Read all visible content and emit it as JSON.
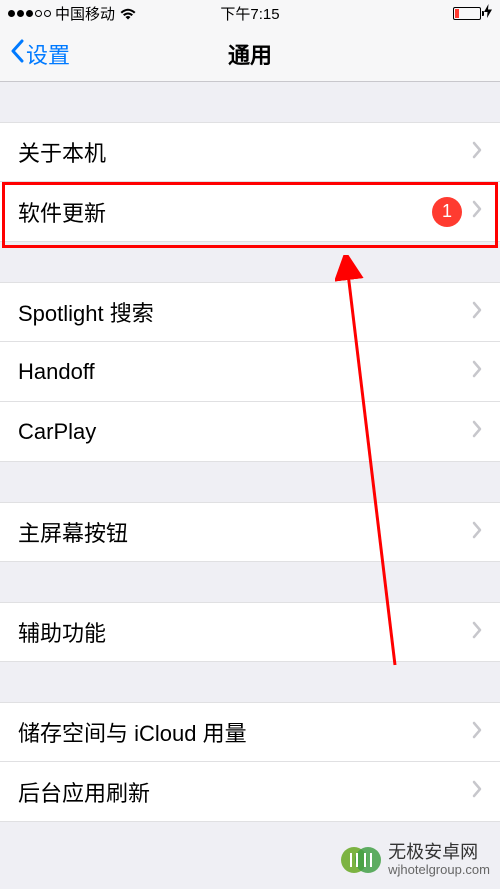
{
  "status": {
    "carrier": "中国移动",
    "time": "下午7:15"
  },
  "nav": {
    "back_label": "设置",
    "title": "通用"
  },
  "groups": [
    {
      "rows": [
        {
          "label": "关于本机",
          "badge": null
        },
        {
          "label": "软件更新",
          "badge": "1"
        }
      ]
    },
    {
      "rows": [
        {
          "label": "Spotlight 搜索",
          "badge": null
        },
        {
          "label": "Handoff",
          "badge": null
        },
        {
          "label": "CarPlay",
          "badge": null
        }
      ]
    },
    {
      "rows": [
        {
          "label": "主屏幕按钮",
          "badge": null
        }
      ]
    },
    {
      "rows": [
        {
          "label": "辅助功能",
          "badge": null
        }
      ]
    },
    {
      "rows": [
        {
          "label": "储存空间与 iCloud 用量",
          "badge": null
        },
        {
          "label": "后台应用刷新",
          "badge": null
        }
      ]
    }
  ],
  "watermark": {
    "title": "无极安卓网",
    "url": "wjhotelgroup.com"
  }
}
